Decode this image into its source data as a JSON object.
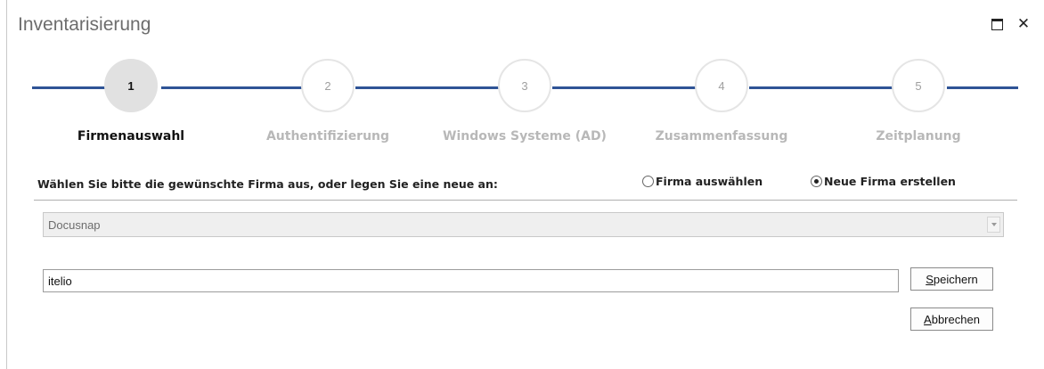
{
  "window": {
    "title": "Inventarisierung",
    "maximize_icon": "maximize-icon",
    "close_icon": "close-icon",
    "close_glyph": "✕"
  },
  "stepper": {
    "accent": "#2f5496",
    "active_index": 0,
    "steps": [
      {
        "number": "1",
        "label": "Firmenauswahl"
      },
      {
        "number": "2",
        "label": "Authentifizierung"
      },
      {
        "number": "3",
        "label": "Windows Systeme (AD)"
      },
      {
        "number": "4",
        "label": "Zusammenfassung"
      },
      {
        "number": "5",
        "label": "Zeitplanung"
      }
    ]
  },
  "form": {
    "prompt": "Wählen Sie bitte die gewünschte Firma aus, oder legen Sie eine neue an:",
    "radio_select": {
      "label": "Firma auswählen",
      "checked": false
    },
    "radio_new": {
      "label": "Neue Firma erstellen",
      "checked": true
    },
    "company_combo": {
      "value": "Docusnap",
      "enabled": false
    },
    "new_company_input": {
      "value": "itelio"
    },
    "save_button": {
      "accel": "S",
      "rest": "peichern"
    },
    "cancel_button": {
      "accel": "A",
      "rest": "bbrechen"
    }
  }
}
